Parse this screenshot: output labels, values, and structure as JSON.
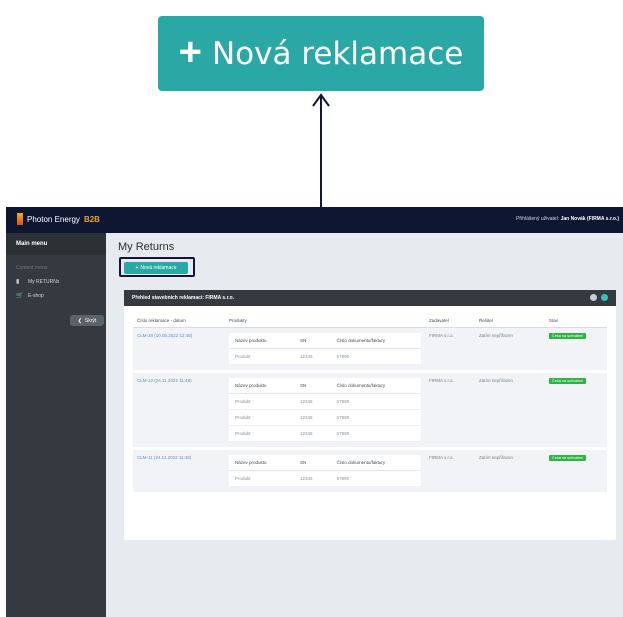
{
  "callout": {
    "plus": "+",
    "label": "Nová reklamace"
  },
  "topbar": {
    "brand": "Photon Energy",
    "brand_suffix": "B2B",
    "user_prefix": "Přihlášený uživatel:",
    "user_name": "Jan Novák (FIRMA s.r.o.)"
  },
  "sidebar": {
    "main_menu": "Main menu",
    "section_label": "Content menu",
    "items": [
      {
        "label": "My RETURNs",
        "icon": "file-icon"
      },
      {
        "label": "E-shop",
        "icon": "cart-icon"
      }
    ],
    "collapse_label": "Skrýt"
  },
  "main": {
    "title": "My Returns",
    "new_button": {
      "plus": "+",
      "label": "Nová reklamace"
    }
  },
  "card": {
    "title": "Přehled stavebních reklamací: FIRMA s.r.o.",
    "dot_colors": [
      "#c9ced4",
      "#35c1c0"
    ],
    "columns": [
      "Číslo reklamace - datum",
      "Produkty",
      "Zadavatel",
      "Řešitel",
      "Stav"
    ],
    "inner_columns": [
      "Název produktu",
      "SN",
      "Číslo dokumentu/faktury"
    ],
    "rows": [
      {
        "claim": "CLM-28 (10.05.2022 12:49)",
        "products": [
          {
            "name": "Produkt",
            "sn": "12345",
            "doc": "67890"
          }
        ],
        "requester": "FIRMA s.r.o.",
        "solver": "Zatím nepřiřazen",
        "status": "Čeká na schválení"
      },
      {
        "claim": "CLM-12 (24.11.2022 11:48)",
        "products": [
          {
            "name": "Produkt",
            "sn": "12345",
            "doc": "67890"
          },
          {
            "name": "Produkt",
            "sn": "12345",
            "doc": "67890"
          },
          {
            "name": "Produkt",
            "sn": "12345",
            "doc": "67890"
          }
        ],
        "requester": "FIRMA s.r.o.",
        "solver": "Zatím nepřiřazen",
        "status": "Čeká na schválení"
      },
      {
        "claim": "CLM-11 (24.11.2022 11:48)",
        "products": [
          {
            "name": "Produkt",
            "sn": "12345",
            "doc": "67890"
          }
        ],
        "requester": "FIRMA s.r.o.",
        "solver": "Zatím nepřiřazen",
        "status": "Čeká na schválení"
      }
    ]
  }
}
